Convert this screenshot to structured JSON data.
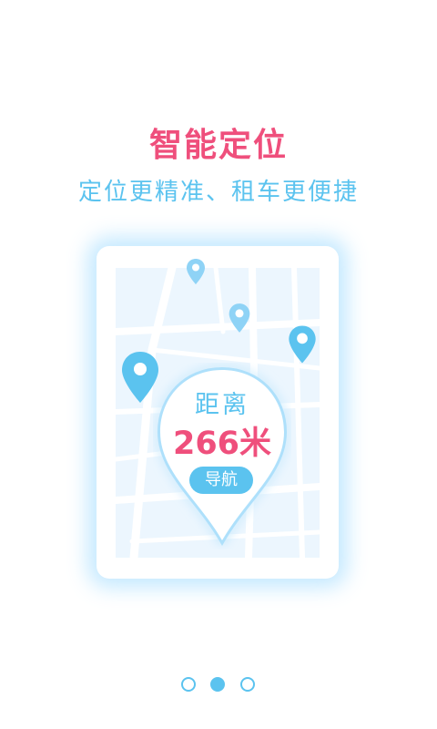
{
  "header": {
    "title": "智能定位",
    "subtitle": "定位更精准、租车更便捷"
  },
  "distance_card": {
    "label": "距离",
    "value": "266米",
    "nav_button": "导航"
  },
  "pagination": {
    "total": 3,
    "active_index": 1
  },
  "icons": {
    "map_pin": "location-pin-icon"
  },
  "colors": {
    "accent_pink": "#ef4f7c",
    "accent_blue": "#5bc3ef",
    "map_background": "#ecf6fe"
  }
}
